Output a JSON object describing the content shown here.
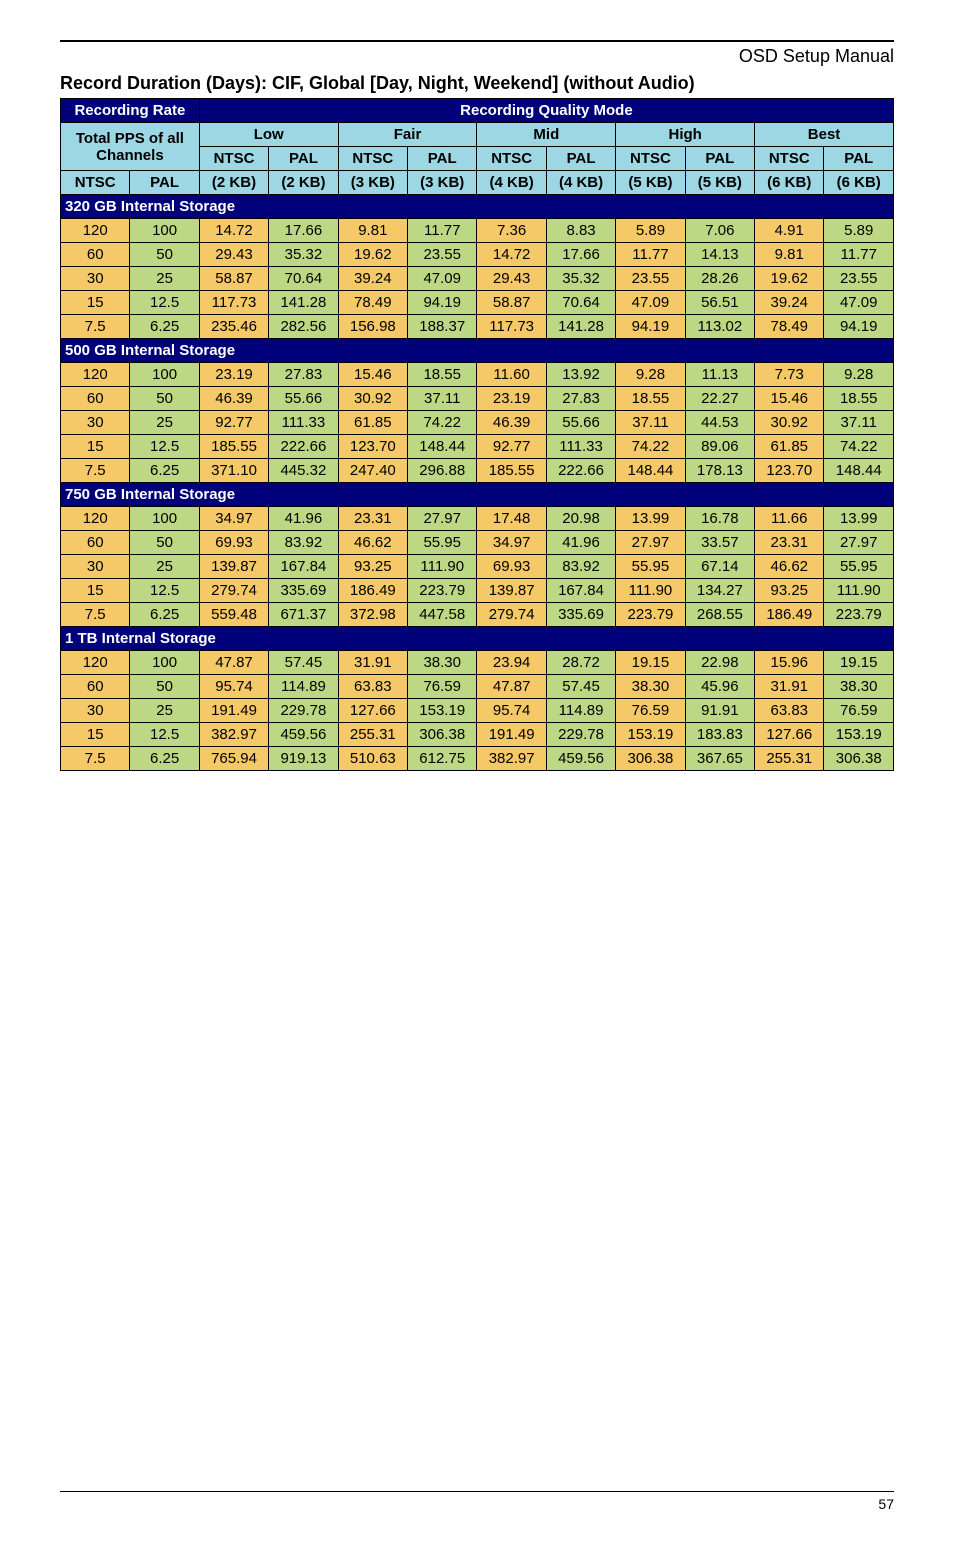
{
  "header": "OSD  Setup  Manual",
  "title": "Record Duration (Days): CIF, Global [Day, Night, Weekend] (without Audio)",
  "headers": {
    "recording_rate": "Recording Rate",
    "quality_mode": "Recording Quality Mode",
    "total_pps": "Total PPS of all Channels",
    "qualities": [
      "Low",
      "Fair",
      "Mid",
      "High",
      "Best"
    ],
    "ntsc": "NTSC",
    "pal": "PAL",
    "kb": [
      "(2 KB)",
      "(2 KB)",
      "(3 KB)",
      "(3 KB)",
      "(4 KB)",
      "(4 KB)",
      "(5 KB)",
      "(5 KB)",
      "(6 KB)",
      "(6 KB)"
    ]
  },
  "page_number": "57",
  "chart_data": {
    "type": "table",
    "title": "Record Duration (Days): CIF, Global [Day, Night, Weekend] (without Audio)",
    "sections": [
      {
        "name": "320 GB Internal Storage",
        "rows": [
          {
            "ntsc": "120",
            "pal": "100",
            "v": [
              "14.72",
              "17.66",
              "9.81",
              "11.77",
              "7.36",
              "8.83",
              "5.89",
              "7.06",
              "4.91",
              "5.89"
            ]
          },
          {
            "ntsc": "60",
            "pal": "50",
            "v": [
              "29.43",
              "35.32",
              "19.62",
              "23.55",
              "14.72",
              "17.66",
              "11.77",
              "14.13",
              "9.81",
              "11.77"
            ]
          },
          {
            "ntsc": "30",
            "pal": "25",
            "v": [
              "58.87",
              "70.64",
              "39.24",
              "47.09",
              "29.43",
              "35.32",
              "23.55",
              "28.26",
              "19.62",
              "23.55"
            ]
          },
          {
            "ntsc": "15",
            "pal": "12.5",
            "v": [
              "117.73",
              "141.28",
              "78.49",
              "94.19",
              "58.87",
              "70.64",
              "47.09",
              "56.51",
              "39.24",
              "47.09"
            ]
          },
          {
            "ntsc": "7.5",
            "pal": "6.25",
            "v": [
              "235.46",
              "282.56",
              "156.98",
              "188.37",
              "117.73",
              "141.28",
              "94.19",
              "113.02",
              "78.49",
              "94.19"
            ]
          }
        ]
      },
      {
        "name": "500 GB Internal Storage",
        "rows": [
          {
            "ntsc": "120",
            "pal": "100",
            "v": [
              "23.19",
              "27.83",
              "15.46",
              "18.55",
              "11.60",
              "13.92",
              "9.28",
              "11.13",
              "7.73",
              "9.28"
            ]
          },
          {
            "ntsc": "60",
            "pal": "50",
            "v": [
              "46.39",
              "55.66",
              "30.92",
              "37.11",
              "23.19",
              "27.83",
              "18.55",
              "22.27",
              "15.46",
              "18.55"
            ]
          },
          {
            "ntsc": "30",
            "pal": "25",
            "v": [
              "92.77",
              "111.33",
              "61.85",
              "74.22",
              "46.39",
              "55.66",
              "37.11",
              "44.53",
              "30.92",
              "37.11"
            ]
          },
          {
            "ntsc": "15",
            "pal": "12.5",
            "v": [
              "185.55",
              "222.66",
              "123.70",
              "148.44",
              "92.77",
              "111.33",
              "74.22",
              "89.06",
              "61.85",
              "74.22"
            ]
          },
          {
            "ntsc": "7.5",
            "pal": "6.25",
            "v": [
              "371.10",
              "445.32",
              "247.40",
              "296.88",
              "185.55",
              "222.66",
              "148.44",
              "178.13",
              "123.70",
              "148.44"
            ]
          }
        ]
      },
      {
        "name": "750 GB Internal Storage",
        "rows": [
          {
            "ntsc": "120",
            "pal": "100",
            "v": [
              "34.97",
              "41.96",
              "23.31",
              "27.97",
              "17.48",
              "20.98",
              "13.99",
              "16.78",
              "11.66",
              "13.99"
            ]
          },
          {
            "ntsc": "60",
            "pal": "50",
            "v": [
              "69.93",
              "83.92",
              "46.62",
              "55.95",
              "34.97",
              "41.96",
              "27.97",
              "33.57",
              "23.31",
              "27.97"
            ]
          },
          {
            "ntsc": "30",
            "pal": "25",
            "v": [
              "139.87",
              "167.84",
              "93.25",
              "111.90",
              "69.93",
              "83.92",
              "55.95",
              "67.14",
              "46.62",
              "55.95"
            ]
          },
          {
            "ntsc": "15",
            "pal": "12.5",
            "v": [
              "279.74",
              "335.69",
              "186.49",
              "223.79",
              "139.87",
              "167.84",
              "111.90",
              "134.27",
              "93.25",
              "111.90"
            ]
          },
          {
            "ntsc": "7.5",
            "pal": "6.25",
            "v": [
              "559.48",
              "671.37",
              "372.98",
              "447.58",
              "279.74",
              "335.69",
              "223.79",
              "268.55",
              "186.49",
              "223.79"
            ]
          }
        ]
      },
      {
        "name": "1 TB Internal Storage",
        "rows": [
          {
            "ntsc": "120",
            "pal": "100",
            "v": [
              "47.87",
              "57.45",
              "31.91",
              "38.30",
              "23.94",
              "28.72",
              "19.15",
              "22.98",
              "15.96",
              "19.15"
            ]
          },
          {
            "ntsc": "60",
            "pal": "50",
            "v": [
              "95.74",
              "114.89",
              "63.83",
              "76.59",
              "47.87",
              "57.45",
              "38.30",
              "45.96",
              "31.91",
              "38.30"
            ]
          },
          {
            "ntsc": "30",
            "pal": "25",
            "v": [
              "191.49",
              "229.78",
              "127.66",
              "153.19",
              "95.74",
              "114.89",
              "76.59",
              "91.91",
              "63.83",
              "76.59"
            ]
          },
          {
            "ntsc": "15",
            "pal": "12.5",
            "v": [
              "382.97",
              "459.56",
              "255.31",
              "306.38",
              "191.49",
              "229.78",
              "153.19",
              "183.83",
              "127.66",
              "153.19"
            ]
          },
          {
            "ntsc": "7.5",
            "pal": "6.25",
            "v": [
              "765.94",
              "919.13",
              "510.63",
              "612.75",
              "382.97",
              "459.56",
              "306.38",
              "367.65",
              "255.31",
              "306.38"
            ]
          }
        ]
      }
    ]
  }
}
